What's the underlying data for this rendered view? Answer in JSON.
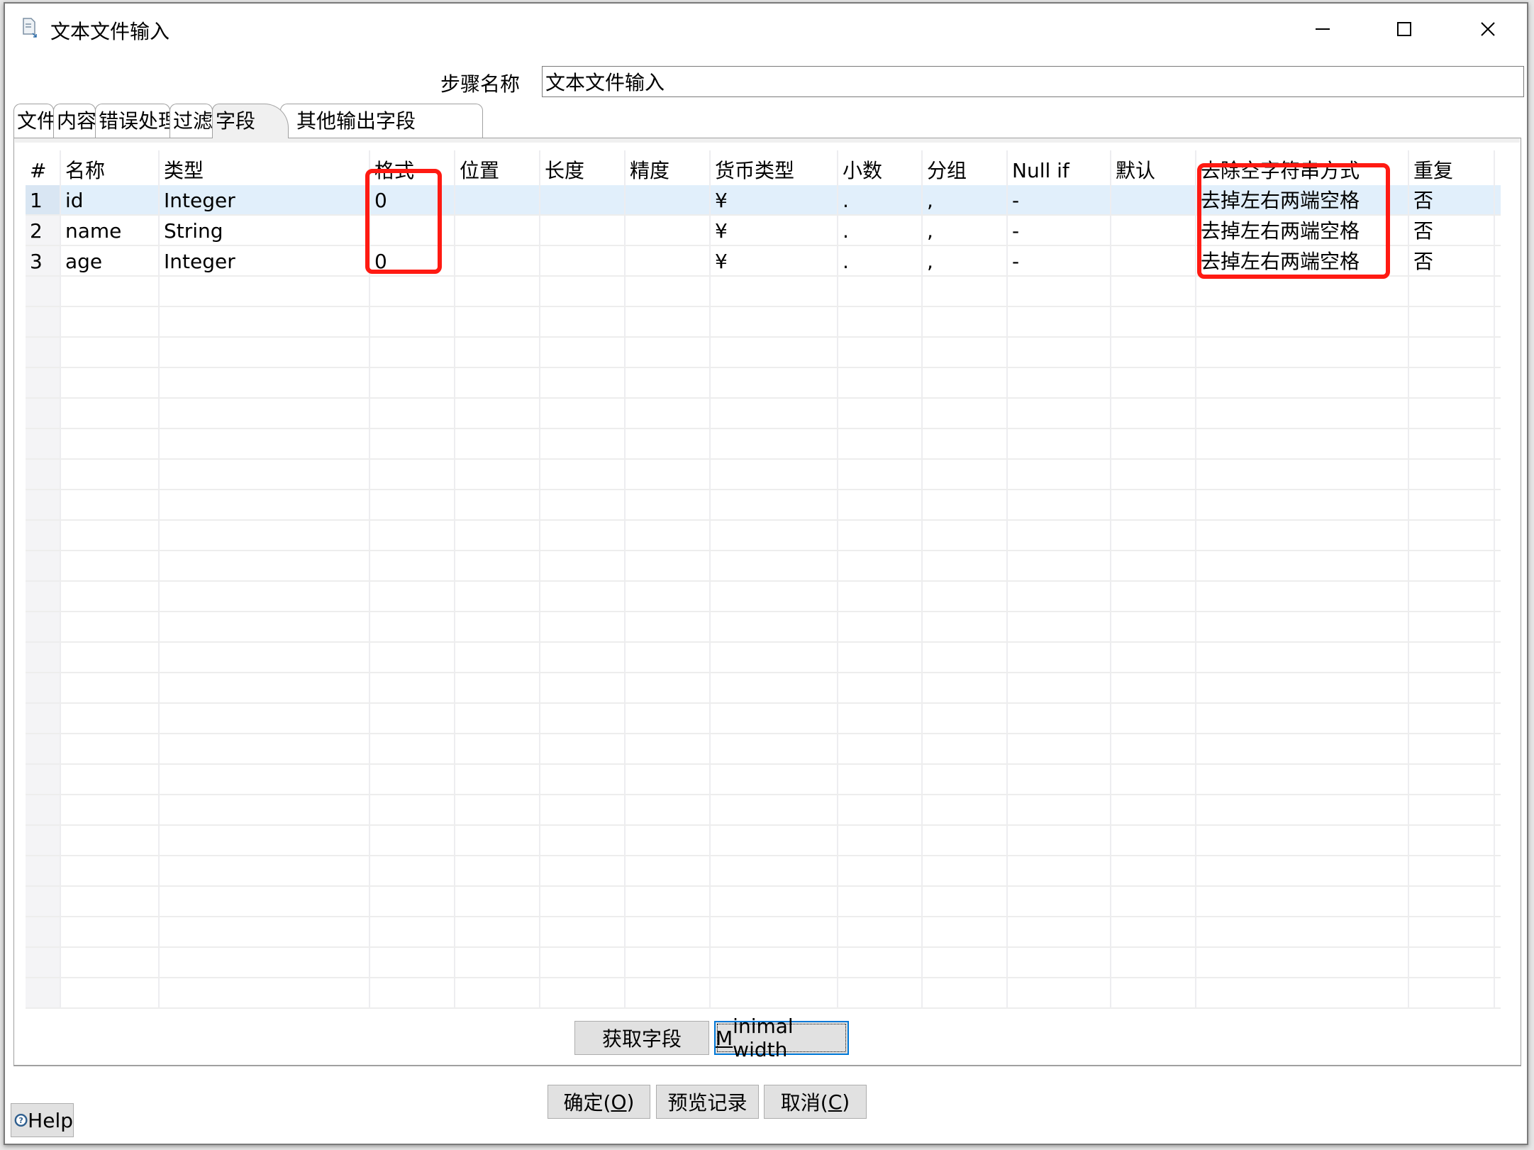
{
  "window": {
    "title": "文本文件输入",
    "controls": {
      "minimize": "—",
      "maximize": "☐",
      "close": "✕"
    }
  },
  "step_name": {
    "label": "步骤名称",
    "value": "文本文件输入"
  },
  "tabs": [
    {
      "label": "文件",
      "active": false
    },
    {
      "label": "内容",
      "active": false
    },
    {
      "label": "错误处理",
      "active": false
    },
    {
      "label": "过滤",
      "active": false
    },
    {
      "label": "字段",
      "active": true
    },
    {
      "label": "其他输出字段",
      "active": false
    }
  ],
  "table": {
    "columns": [
      "#",
      "名称",
      "类型",
      "格式",
      "位置",
      "长度",
      "精度",
      "货币类型",
      "小数",
      "分组",
      "Null if",
      "默认",
      "去除空字符串方式",
      "重复"
    ],
    "rows": [
      [
        "1",
        "id",
        "Integer",
        "0",
        "",
        "",
        "",
        "¥",
        ".",
        ",",
        "-",
        "",
        "去掉左右两端空格",
        "否"
      ],
      [
        "2",
        "name",
        "String",
        "",
        "",
        "",
        "",
        "¥",
        ".",
        ",",
        "-",
        "",
        "去掉左右两端空格",
        "否"
      ],
      [
        "3",
        "age",
        "Integer",
        "0",
        "",
        "",
        "",
        "¥",
        ".",
        ",",
        "-",
        "",
        "去掉左右两端空格",
        "否"
      ]
    ],
    "selected_row": 0,
    "highlight_color": "#ff1a12"
  },
  "panel_buttons": {
    "get_fields": "获取字段",
    "minimal_width_prefix": "M",
    "minimal_width_rest": "inimal width"
  },
  "footer": {
    "ok_label": "确定(",
    "ok_key": "O",
    "ok_suffix": ")",
    "preview_label": "预览记录",
    "cancel_label": "取消(",
    "cancel_key": "C",
    "cancel_suffix": ")",
    "help_label": "Help"
  }
}
